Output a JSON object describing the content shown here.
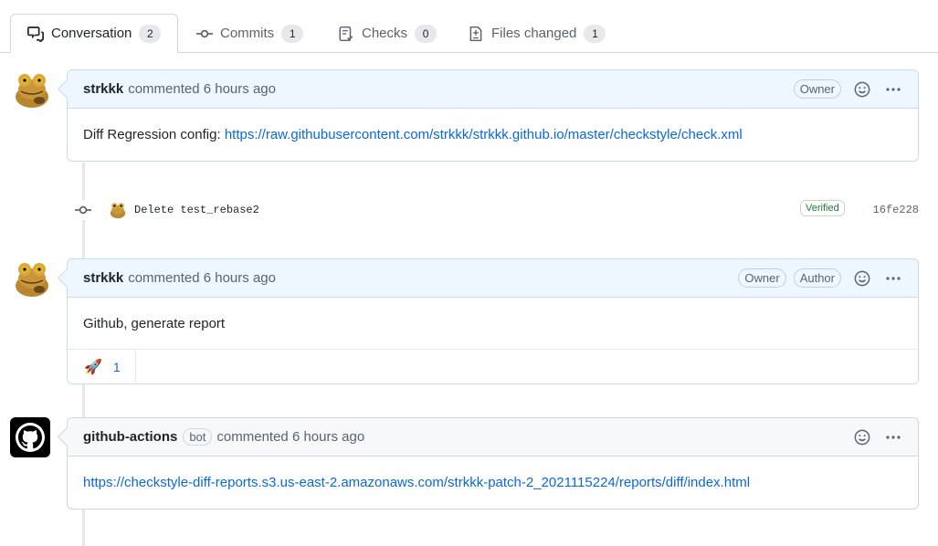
{
  "tabs": [
    {
      "label": "Conversation",
      "count": "2",
      "icon": "comment-discussion-icon"
    },
    {
      "label": "Commits",
      "count": "1",
      "icon": "git-commit-icon"
    },
    {
      "label": "Checks",
      "count": "0",
      "icon": "checklist-icon"
    },
    {
      "label": "Files changed",
      "count": "1",
      "icon": "file-diff-icon"
    }
  ],
  "comments": [
    {
      "author": "strkkk",
      "meta": "commented 6 hours ago",
      "badges": [
        "Owner"
      ],
      "body_text": "Diff Regression config: ",
      "body_link": "https://raw.githubusercontent.com/strkkk/strkkk.github.io/master/checkstyle/check.xml"
    },
    {
      "author": "strkkk",
      "meta": "commented 6 hours ago",
      "badges": [
        "Owner",
        "Author"
      ],
      "body_text": "Github, generate report",
      "reaction_emoji": "🚀",
      "reaction_count": "1"
    },
    {
      "author": "github-actions",
      "bot_label": "bot",
      "meta": "commented 6 hours ago",
      "body_link": "https://checkstyle-diff-reports.s3.us-east-2.amazonaws.com/strkkk-patch-2_2021115224/reports/diff/index.html"
    }
  ],
  "commit": {
    "message": "Delete test_rebase2",
    "verified": "Verified",
    "sha": "16fe228"
  },
  "colors": {
    "link": "#0969da",
    "header_highlight": "#eef6ff",
    "verified": "#1a7f37"
  }
}
